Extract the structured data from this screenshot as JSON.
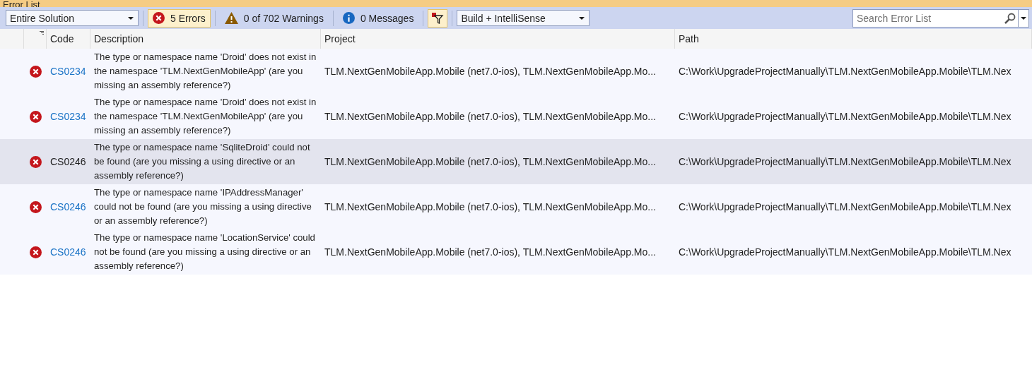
{
  "window": {
    "title": "Error List"
  },
  "toolbar": {
    "scope": "Entire Solution",
    "errors": {
      "label": "5 Errors",
      "selected": true
    },
    "warnings": {
      "label": "0 of 702 Warnings",
      "selected": false
    },
    "messages": {
      "label": "0 Messages",
      "selected": false
    },
    "filter": {
      "selected": true
    },
    "source": "Build + IntelliSense",
    "search": {
      "placeholder": "Search Error List"
    }
  },
  "table": {
    "columns": [
      "Code",
      "Description",
      "Project",
      "Path"
    ],
    "rows": [
      {
        "code": "CS0234",
        "description": "The type or namespace name 'Droid' does not exist in the namespace 'TLM.NextGenMobileApp' (are you missing an assembly reference?)",
        "project": "TLM.NextGenMobileApp.Mobile (net7.0-ios), TLM.NextGenMobileApp.Mo...",
        "path": "C:\\Work\\UpgradeProjectManually\\TLM.NextGenMobileApp.Mobile\\TLM.Nex",
        "selected": false
      },
      {
        "code": "CS0234",
        "description": "The type or namespace name 'Droid' does not exist in the namespace 'TLM.NextGenMobileApp' (are you missing an assembly reference?)",
        "project": "TLM.NextGenMobileApp.Mobile (net7.0-ios), TLM.NextGenMobileApp.Mo...",
        "path": "C:\\Work\\UpgradeProjectManually\\TLM.NextGenMobileApp.Mobile\\TLM.Nex",
        "selected": false
      },
      {
        "code": "CS0246",
        "description": "The type or namespace name 'SqliteDroid' could not be found (are you missing a using directive or an assembly reference?)",
        "project": "TLM.NextGenMobileApp.Mobile (net7.0-ios), TLM.NextGenMobileApp.Mo...",
        "path": "C:\\Work\\UpgradeProjectManually\\TLM.NextGenMobileApp.Mobile\\TLM.Nex",
        "selected": true
      },
      {
        "code": "CS0246",
        "description": "The type or namespace name 'IPAddressManager' could not be found (are you missing a using directive or an assembly reference?)",
        "project": "TLM.NextGenMobileApp.Mobile (net7.0-ios), TLM.NextGenMobileApp.Mo...",
        "path": "C:\\Work\\UpgradeProjectManually\\TLM.NextGenMobileApp.Mobile\\TLM.Nex",
        "selected": false
      },
      {
        "code": "CS0246",
        "description": "The type or namespace name 'LocationService' could not be found (are you missing a using directive or an assembly reference?)",
        "project": "TLM.NextGenMobileApp.Mobile (net7.0-ios), TLM.NextGenMobileApp.Mo...",
        "path": "C:\\Work\\UpgradeProjectManually\\TLM.NextGenMobileApp.Mobile\\TLM.Nex",
        "selected": false
      }
    ]
  }
}
